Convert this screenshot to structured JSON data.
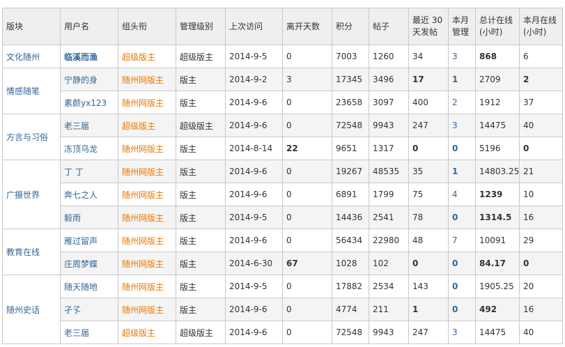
{
  "headers": [
    "版块",
    "用户名",
    "组头衔",
    "管理级别",
    "上次访问",
    "离开天数",
    "积分",
    "帖子",
    "最近 30 天发帖",
    "本月管理",
    "总计在线 (小时)",
    "本月在线 (小时)"
  ],
  "sections": [
    {
      "name": "文化随州",
      "rows": [
        {
          "user": "临溪而渔",
          "user_bold": true,
          "title": "超级版主",
          "level": "超级版主",
          "last": "2014-9-5",
          "away": "0",
          "away_bold": false,
          "credits": "7003",
          "posts": "1260",
          "recent": "34",
          "recent_bold": false,
          "manage": "3",
          "manage_bold": false,
          "total": "868",
          "total_bold": true,
          "month": "6",
          "month_bold": false
        }
      ]
    },
    {
      "name": "情感随笔",
      "rows": [
        {
          "user": "宁静的身",
          "user_bold": false,
          "title": "随州网版主",
          "level": "版主",
          "last": "2014-9-2",
          "away": "3",
          "away_bold": false,
          "credits": "17345",
          "posts": "3496",
          "recent": "17",
          "recent_bold": true,
          "manage": "1",
          "manage_bold": true,
          "total": "2709",
          "total_bold": false,
          "month": "2",
          "month_bold": true
        },
        {
          "user": "素颜yx123",
          "user_bold": false,
          "title": "随州网版主",
          "level": "版主",
          "last": "2014-9-6",
          "away": "0",
          "away_bold": false,
          "credits": "23658",
          "posts": "3097",
          "recent": "400",
          "recent_bold": false,
          "manage": "2",
          "manage_bold": false,
          "total": "1912",
          "total_bold": false,
          "month": "37",
          "month_bold": false
        }
      ]
    },
    {
      "name": "方言与习俗",
      "rows": [
        {
          "user": "老三届",
          "user_bold": false,
          "title": "超级版主",
          "level": "超级版主",
          "last": "2014-9-6",
          "away": "0",
          "away_bold": false,
          "credits": "72548",
          "posts": "9943",
          "recent": "247",
          "recent_bold": false,
          "manage": "3",
          "manage_bold": false,
          "total": "14475",
          "total_bold": false,
          "month": "40",
          "month_bold": false
        },
        {
          "user": "冻顶乌龙",
          "user_bold": false,
          "title": "随州网版主",
          "level": "版主",
          "last": "2014-8-14",
          "away": "22",
          "away_bold": true,
          "credits": "9651",
          "posts": "1317",
          "recent": "0",
          "recent_bold": true,
          "manage": "0",
          "manage_bold": true,
          "total": "5196",
          "total_bold": false,
          "month": "0",
          "month_bold": true
        }
      ]
    },
    {
      "name": "广摄世界",
      "rows": [
        {
          "user": "丁 丁",
          "user_bold": false,
          "title": "随州网版主",
          "level": "版主",
          "last": "2014-9-6",
          "away": "0",
          "away_bold": false,
          "credits": "19267",
          "posts": "48535",
          "recent": "35",
          "recent_bold": false,
          "manage": "1",
          "manage_bold": true,
          "total": "14803.25",
          "total_bold": false,
          "month": "21",
          "month_bold": false
        },
        {
          "user": "奔七之人",
          "user_bold": false,
          "title": "随州网版主",
          "level": "版主",
          "last": "2014-9-6",
          "away": "0",
          "away_bold": false,
          "credits": "6891",
          "posts": "1799",
          "recent": "75",
          "recent_bold": false,
          "manage": "4",
          "manage_bold": false,
          "total": "1239",
          "total_bold": true,
          "month": "10",
          "month_bold": false
        },
        {
          "user": "毅雨",
          "user_bold": false,
          "title": "随州网版主",
          "level": "版主",
          "last": "2014-9-5",
          "away": "0",
          "away_bold": false,
          "credits": "14436",
          "posts": "2541",
          "recent": "78",
          "recent_bold": false,
          "manage": "0",
          "manage_bold": true,
          "total": "1314.5",
          "total_bold": true,
          "month": "16",
          "month_bold": false
        }
      ]
    },
    {
      "name": "教育在线",
      "rows": [
        {
          "user": "雁过留声",
          "user_bold": false,
          "title": "随州网版主",
          "level": "版主",
          "last": "2014-9-6",
          "away": "0",
          "away_bold": false,
          "credits": "56434",
          "posts": "22980",
          "recent": "48",
          "recent_bold": false,
          "manage": "7",
          "manage_bold": false,
          "total": "10091",
          "total_bold": false,
          "month": "29",
          "month_bold": false
        },
        {
          "user": "庄周梦蝶",
          "user_bold": false,
          "title": "随州网版主",
          "level": "版主",
          "last": "2014-6-30",
          "away": "67",
          "away_bold": true,
          "credits": "1028",
          "posts": "102",
          "recent": "0",
          "recent_bold": true,
          "manage": "0",
          "manage_bold": true,
          "total": "84.17",
          "total_bold": true,
          "month": "0",
          "month_bold": true
        }
      ]
    },
    {
      "name": "随州史话",
      "rows": [
        {
          "user": "随天随地",
          "user_bold": false,
          "title": "随州网版主",
          "level": "版主",
          "last": "2014-9-5",
          "away": "0",
          "away_bold": false,
          "credits": "17882",
          "posts": "2534",
          "recent": "143",
          "recent_bold": false,
          "manage": "0",
          "manage_bold": true,
          "total": "1905.25",
          "total_bold": false,
          "month": "20",
          "month_bold": false
        },
        {
          "user": "孑孓",
          "user_bold": false,
          "title": "随州网版主",
          "level": "版主",
          "last": "2014-9-6",
          "away": "0",
          "away_bold": false,
          "credits": "4774",
          "posts": "211",
          "recent": "1",
          "recent_bold": true,
          "manage": "0",
          "manage_bold": true,
          "total": "492",
          "total_bold": true,
          "month": "16",
          "month_bold": false
        },
        {
          "user": "老三届",
          "user_bold": false,
          "title": "超级版主",
          "level": "超级版主",
          "last": "2014-9-6",
          "away": "0",
          "away_bold": false,
          "credits": "72548",
          "posts": "9943",
          "recent": "247",
          "recent_bold": false,
          "manage": "3",
          "manage_bold": false,
          "total": "14475",
          "total_bold": false,
          "month": "40",
          "month_bold": false
        }
      ]
    }
  ],
  "colors": {
    "link": "#336699",
    "title_orange": "#ee7700",
    "header_bg": "#efefef",
    "alt_row_bg": "#f4f4f4",
    "border": "#c8c8c8"
  }
}
